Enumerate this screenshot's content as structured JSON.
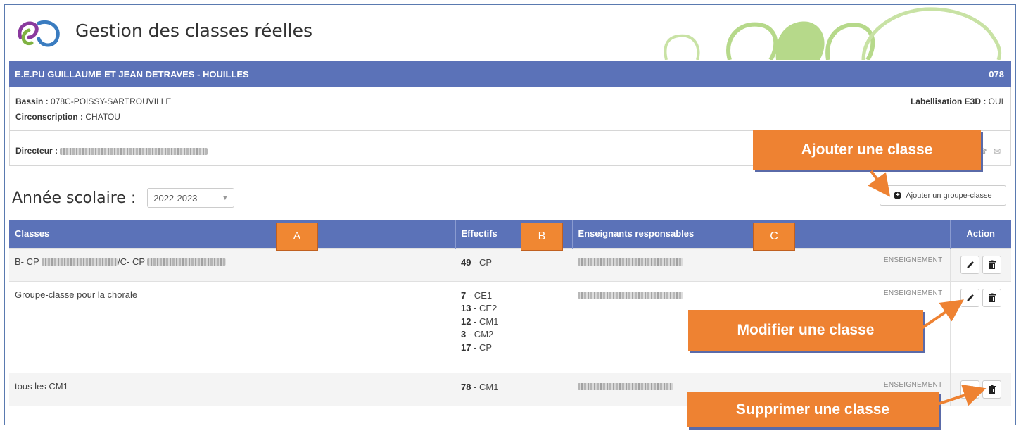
{
  "app": {
    "title": "Gestion des classes réelles"
  },
  "school": {
    "name": "E.E.PU GUILLAUME ET JEAN DETRAVES - HOUILLES",
    "code": "078",
    "bassin_label": "Bassin :",
    "bassin_value": "078C-POISSY-SARTROUVILLE",
    "circonscription_label": "Circonscription :",
    "circonscription_value": "CHATOU",
    "labellisation_label": "Labellisation E3D :",
    "labellisation_value": "OUI",
    "directeur_label": "Directeur :"
  },
  "year": {
    "label": "Année scolaire :",
    "selected": "2022-2023"
  },
  "add_group_button": "Ajouter un groupe-classe",
  "table": {
    "headers": {
      "classes": "Classes",
      "effectifs": "Effectifs",
      "enseignants": "Enseignants responsables",
      "action": "Action"
    },
    "rows": [
      {
        "class_name": "B- CP",
        "class_name_2": "/C- CP",
        "effectifs": [
          {
            "n": "49",
            "level": "- CP"
          }
        ],
        "role": "ENSEIGNEMENT"
      },
      {
        "class_name": "Groupe-classe pour la chorale",
        "class_name_2": "",
        "effectifs": [
          {
            "n": "7",
            "level": "- CE1"
          },
          {
            "n": "13",
            "level": "- CE2"
          },
          {
            "n": "12",
            "level": "- CM1"
          },
          {
            "n": "3",
            "level": "- CM2"
          },
          {
            "n": "17",
            "level": "- CP"
          }
        ],
        "role": "ENSEIGNEMENT"
      },
      {
        "class_name": "tous les CM1",
        "class_name_2": "",
        "effectifs": [
          {
            "n": "78",
            "level": "- CM1"
          }
        ],
        "role": "ENSEIGNEMENT"
      }
    ]
  },
  "annotations": {
    "label_a": "A",
    "label_b": "B",
    "label_c": "C",
    "callout_add": "Ajouter une classe",
    "callout_edit": "Modifier une classe",
    "callout_delete": "Supprimer une classe"
  },
  "colors": {
    "header_blue": "#5b72b8",
    "callout_orange": "#ee8232",
    "callout_shadow": "#5a6aa8",
    "logo_purple": "#8a3a9e",
    "logo_green": "#7fb241",
    "deco_green": "#b6d98a"
  }
}
